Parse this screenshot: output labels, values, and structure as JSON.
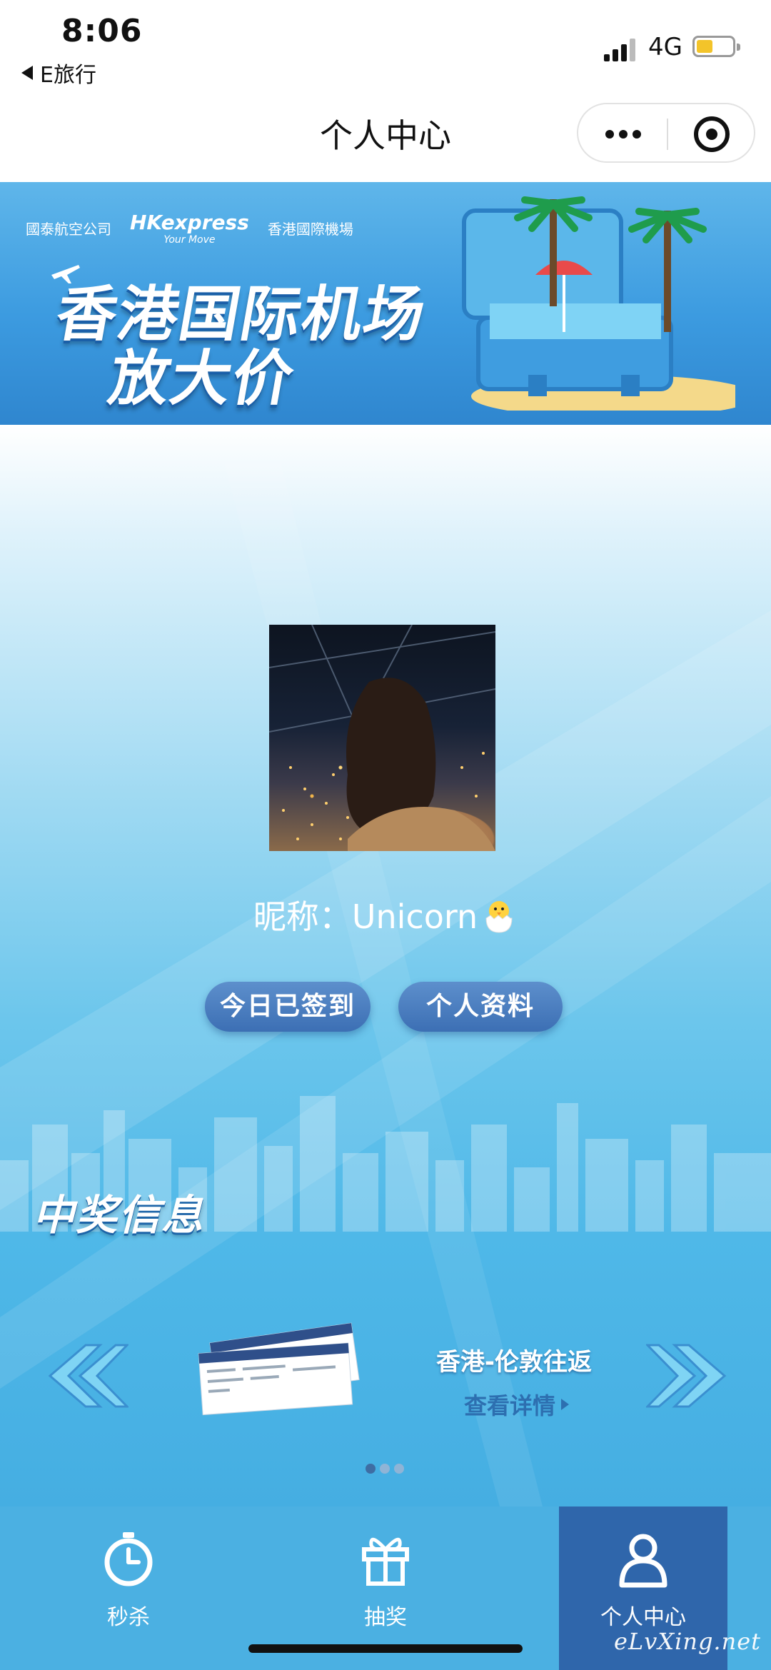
{
  "status_bar": {
    "time": "8:06",
    "back_app": "E旅行",
    "network": "4G",
    "battery_icon": "battery-low-icon",
    "signal_icon": "signal-bars-icon"
  },
  "nav": {
    "title": "个人中心",
    "more_icon": "more-dots-icon",
    "close_icon": "target-circle-icon"
  },
  "banner": {
    "logo_1": "國泰航空公司",
    "logo_2": "HKexpress",
    "logo_2_sub": "Your Move",
    "logo_3": "香港國際機場",
    "title_line_1": "香港国际机场",
    "title_line_2": "放大价"
  },
  "profile": {
    "nickname_label": "昵称：",
    "nickname": "Unicorn",
    "signin_button": "今日已签到",
    "profile_button": "个人资料"
  },
  "prize": {
    "section_title": "中奖信息",
    "items": [
      {
        "route": "香港-伦敦往返",
        "details_label": "查看详情"
      }
    ],
    "pager_count": 3,
    "pager_active": 1
  },
  "tabs": [
    {
      "label": "秒杀",
      "icon": "stopwatch-icon",
      "active": false
    },
    {
      "label": "抽奖",
      "icon": "gift-icon",
      "active": false
    },
    {
      "label": "个人中心",
      "icon": "user-icon",
      "active": true
    }
  ],
  "watermark": "eLvXing.net",
  "colors": {
    "tab_bar": "#4bb0e2",
    "tab_active": "#2f66ab",
    "button": "#3c6fb4",
    "banner": "#3c9be0"
  }
}
